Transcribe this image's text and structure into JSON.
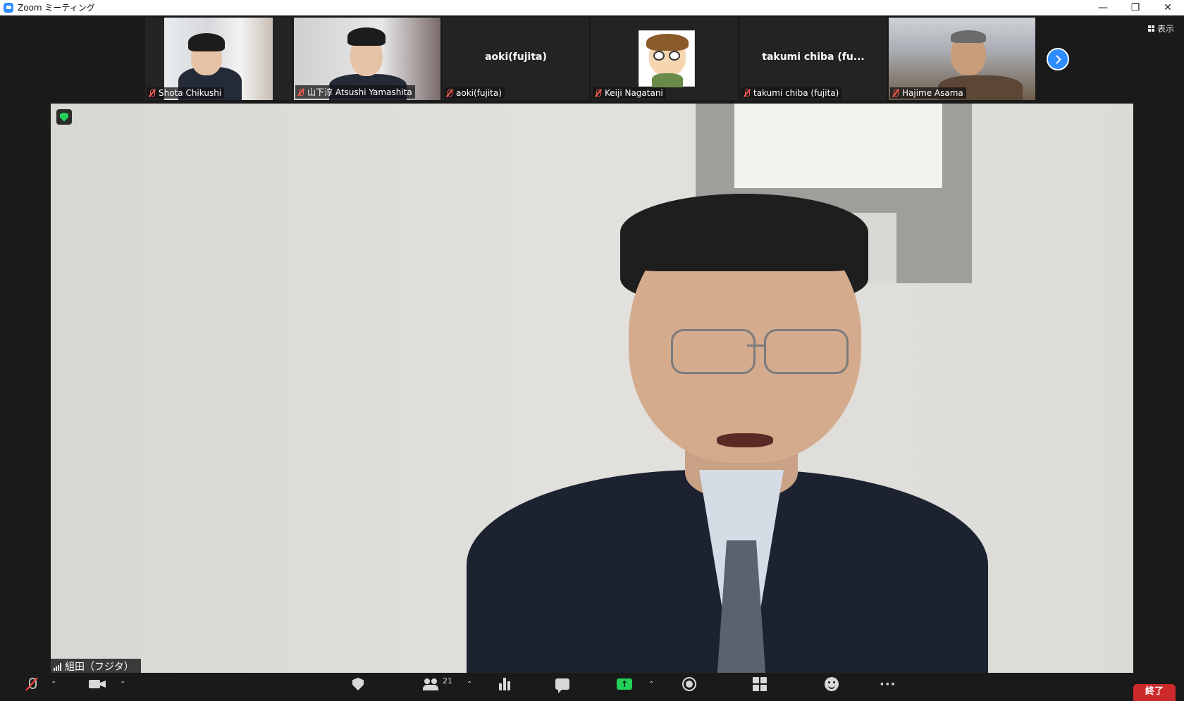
{
  "window": {
    "title": "Zoom ミーティング",
    "controls": [
      "minimize",
      "restore",
      "close"
    ]
  },
  "view_button": {
    "label": "表示",
    "icon": "grid-view-icon"
  },
  "participants_strip": [
    {
      "name": "Shota Chikushi",
      "muted": true,
      "video": true
    },
    {
      "name": "山下淳 Atsushi Yamashita",
      "muted": true,
      "video": true
    },
    {
      "name": "aoki(fujita)",
      "display_center": "aoki(fujita)",
      "muted": true,
      "video": false
    },
    {
      "name": "Keiji Nagatani",
      "muted": true,
      "video": false,
      "avatar": "cartoon"
    },
    {
      "name": "takumi chiba (fujita)",
      "display_center": "takumi chiba (fu...",
      "muted": true,
      "video": false
    },
    {
      "name": "Hajime Asama",
      "muted": true,
      "video": true
    }
  ],
  "main_speaker": {
    "name": "組田（フジタ）",
    "encryption_icon": "shield-check-icon"
  },
  "toolbar": {
    "participants_count": "21",
    "end_label": "終了",
    "share_color": "#23d05a",
    "end_color": "#cc2a2a"
  },
  "colors": {
    "accent": "#2d8cff",
    "muted": "#ff5a4f",
    "encryption": "#23d05a"
  }
}
